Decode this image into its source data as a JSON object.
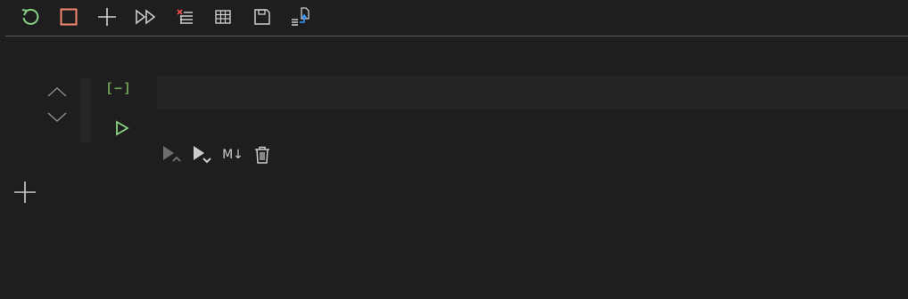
{
  "toolbar": {
    "buttons": [
      {
        "name": "restart-kernel-button",
        "icon": "restart-icon",
        "color": "#89d185"
      },
      {
        "name": "interrupt-kernel-button",
        "icon": "stop-icon",
        "color": "#f48771"
      },
      {
        "name": "add-cell-toolbar-button",
        "icon": "plus-icon",
        "color": "#cccccc"
      },
      {
        "name": "run-all-button",
        "icon": "run-all-icon",
        "color": "#cccccc"
      },
      {
        "name": "clear-outputs-button",
        "icon": "clear-outputs-icon",
        "color": "#cccccc"
      },
      {
        "name": "variables-button",
        "icon": "table-icon",
        "color": "#cccccc"
      },
      {
        "name": "save-button",
        "icon": "save-icon",
        "color": "#cccccc"
      },
      {
        "name": "export-button",
        "icon": "export-icon",
        "color": "#3794ff"
      }
    ]
  },
  "cell": {
    "execution_count": "[−]",
    "input_value": "",
    "accent_color": "#6a9955",
    "run_icon_color": "#89d185",
    "markdown_label": "M↓"
  },
  "icons": {
    "move_up": "chevron-up-icon",
    "move_down": "chevron-down-icon",
    "run_above": "run-above-icon",
    "run_below": "run-below-icon",
    "delete": "trash-icon",
    "add_cell": "plus-icon"
  }
}
